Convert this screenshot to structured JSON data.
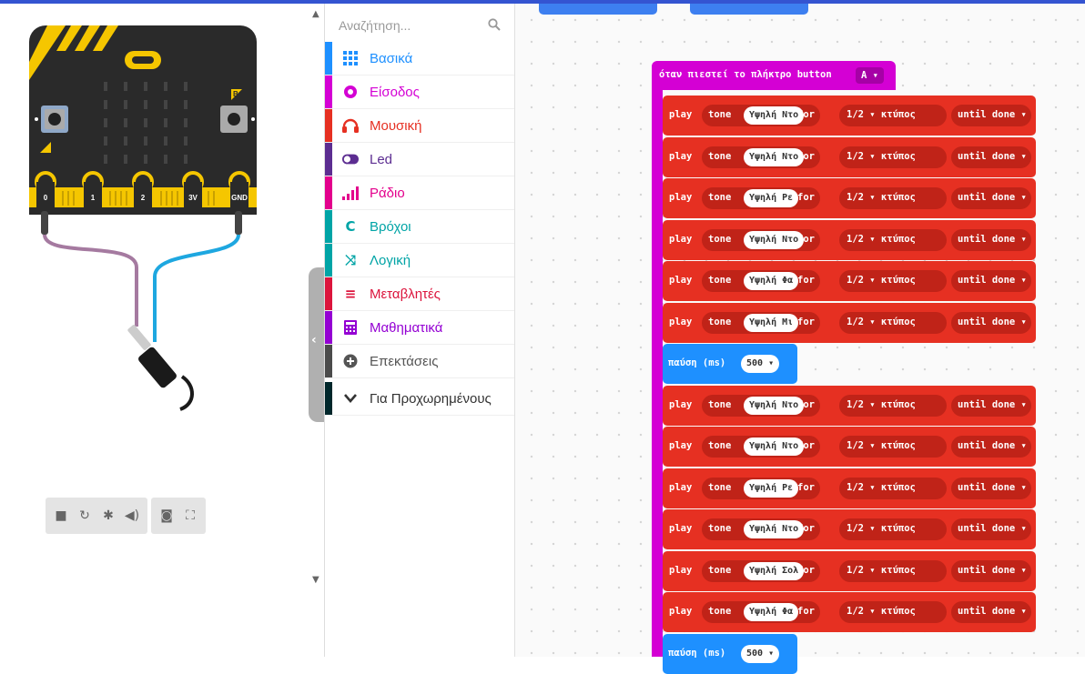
{
  "toolbox": {
    "search_placeholder": "Αναζήτηση...",
    "categories": [
      {
        "label": "Βασικά",
        "color": "#1e90ff",
        "icon": "grid-icon"
      },
      {
        "label": "Είσοδος",
        "color": "#d400d4",
        "icon": "input-circle-icon"
      },
      {
        "label": "Μουσική",
        "color": "#e63022",
        "icon": "headphones-icon"
      },
      {
        "label": "Led",
        "color": "#5c2d91",
        "icon": "toggle-icon"
      },
      {
        "label": "Ράδιο",
        "color": "#e3008c",
        "icon": "signal-bars-icon"
      },
      {
        "label": "Βρόχοι",
        "color": "#00a4a6",
        "icon": "loop-arrow-icon"
      },
      {
        "label": "Λογική",
        "color": "#00a4a6",
        "icon": "shuffle-icon"
      },
      {
        "label": "Μεταβλητές",
        "color": "#dc143c",
        "icon": "list-icon"
      },
      {
        "label": "Μαθηματικά",
        "color": "#9400d3",
        "icon": "calculator-icon"
      },
      {
        "label": "Επεκτάσεις",
        "color": "#4b4b4b",
        "icon": "plus-circle-icon"
      },
      {
        "label": "Για Προχωρημένους",
        "color": "#00272b",
        "icon": "chevron-down-icon"
      }
    ]
  },
  "simulator": {
    "pins": [
      "0",
      "1",
      "2",
      "3V",
      "GND"
    ],
    "button_a": "A",
    "button_b": "B",
    "toolbar": [
      "stop-icon",
      "restart-icon",
      "debug-icon",
      "mute-icon",
      "screenshot-icon",
      "fullscreen-icon"
    ]
  },
  "workspace": {
    "event": {
      "text": "όταν πιεστεί το πλήκτρο button",
      "button": "A ▾"
    },
    "labels": {
      "play": "play",
      "tone": "tone",
      "for": "for",
      "beat": "1/2 ▾ κτύπος",
      "until": "until done ▾",
      "pause": "παύση (ms)",
      "pause_value": "500 ▾"
    },
    "blocks": [
      {
        "type": "play",
        "note": "Υψηλή Ντο"
      },
      {
        "type": "play",
        "note": "Υψηλή Ντο"
      },
      {
        "type": "play",
        "note": "Υψηλή Ρε"
      },
      {
        "type": "play",
        "note": "Υψηλή Ντο"
      },
      {
        "type": "play",
        "note": "Υψηλή Φα"
      },
      {
        "type": "play",
        "note": "Υψηλή Μι"
      },
      {
        "type": "pause"
      },
      {
        "type": "play",
        "note": "Υψηλή Ντο"
      },
      {
        "type": "play",
        "note": "Υψηλή Ντο"
      },
      {
        "type": "play",
        "note": "Υψηλή Ρε"
      },
      {
        "type": "play",
        "note": "Υψηλή Ντο"
      },
      {
        "type": "play",
        "note": "Υψηλή Σολ"
      },
      {
        "type": "play",
        "note": "Υψηλή Φα"
      },
      {
        "type": "pause"
      }
    ]
  }
}
